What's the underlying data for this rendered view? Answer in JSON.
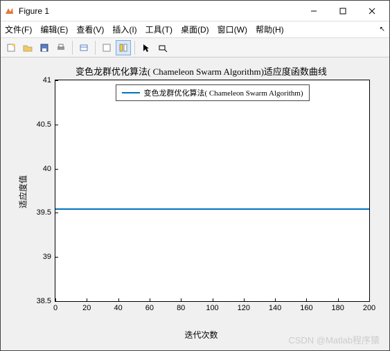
{
  "window": {
    "title": "Figure 1"
  },
  "menu": {
    "file": "文件(F)",
    "edit": "编辑(E)",
    "view": "查看(V)",
    "insert": "插入(I)",
    "tools": "工具(T)",
    "desktop": "桌面(D)",
    "window": "窗口(W)",
    "help": "帮助(H)"
  },
  "toolbar_icons": {
    "new": "new-figure",
    "open": "open-file",
    "save": "save",
    "print": "print",
    "link": "link",
    "layout1": "layout-single",
    "layout2": "layout-tiled",
    "arrow": "edit-plot-arrow",
    "cursor": "data-cursor"
  },
  "chart_data": {
    "type": "line",
    "title": "变色龙群优化算法( Chameleon Swarm Algorithm)适应度函数曲线",
    "xlabel": "迭代次数",
    "ylabel": "适应度值",
    "xlim": [
      0,
      200
    ],
    "ylim": [
      38.5,
      41
    ],
    "xticks": [
      0,
      20,
      40,
      60,
      80,
      100,
      120,
      140,
      160,
      180,
      200
    ],
    "yticks": [
      38.5,
      39,
      39.5,
      40,
      40.5,
      41
    ],
    "series": [
      {
        "name": "变色龙群优化算法( Chameleon Swarm Algorithm)",
        "color": "#0072bd",
        "x": [
          0,
          20,
          40,
          60,
          80,
          100,
          120,
          140,
          160,
          180,
          200
        ],
        "y": [
          39.55,
          39.55,
          39.55,
          39.55,
          39.55,
          39.55,
          39.55,
          39.55,
          39.55,
          39.55,
          39.55
        ]
      }
    ],
    "legend": {
      "position": "north",
      "entries": [
        "变色龙群优化算法( Chameleon Swarm Algorithm)"
      ]
    }
  },
  "watermark": "CSDN @Matlab程序猿"
}
